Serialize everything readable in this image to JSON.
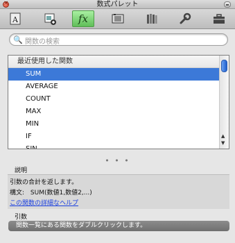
{
  "window": {
    "title": "数式パレット"
  },
  "toolbar": {
    "items": [
      {
        "name": "format-text-icon"
      },
      {
        "name": "insert-image-icon"
      },
      {
        "name": "functions-fx-icon",
        "label": "fx",
        "active": true
      },
      {
        "name": "photo-browser-icon"
      },
      {
        "name": "reference-books-icon"
      },
      {
        "name": "tools-wrench-icon"
      },
      {
        "name": "toolbox-icon"
      }
    ]
  },
  "search": {
    "placeholder": "関数の検索"
  },
  "function_list": {
    "header": "最近使用した関数",
    "items": [
      "SUM",
      "AVERAGE",
      "COUNT",
      "MAX",
      "MIN",
      "IF",
      "SIN"
    ],
    "selected": "SUM"
  },
  "description": {
    "label": "説明",
    "text": "引数の合計を返します。",
    "syntax_label": "構文:",
    "syntax": "SUM(数値1,数値2,...)",
    "help_link": "この関数の詳細なヘルプ"
  },
  "arguments": {
    "label": "引数",
    "message": "関数一覧にある関数をダブルクリックします。"
  },
  "colors": {
    "selection": "#3c79d8",
    "active_tab": "#7bd472",
    "link": "#1a3fe0",
    "args_bar": "#7a7a7a"
  }
}
